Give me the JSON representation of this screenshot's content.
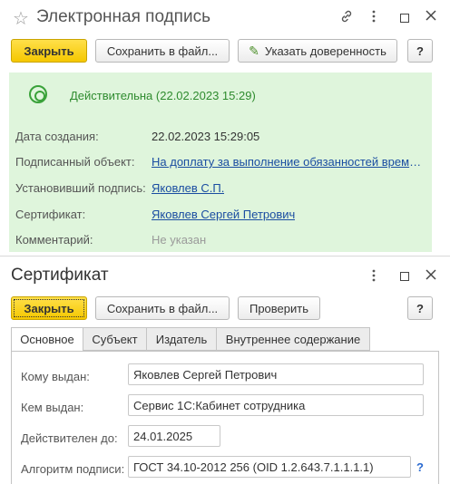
{
  "window1": {
    "title": "Электронная подпись",
    "buttons": {
      "close": "Закрыть",
      "save_to_file": "Сохранить в файл...",
      "set_proxy": "Указать доверенность",
      "help": "?"
    },
    "status": "Действительна (22.02.2023 15:29)",
    "fields": [
      {
        "label": "Дата создания:",
        "value": "22.02.2023 15:29:05"
      },
      {
        "label": "Подписанный объект:",
        "value": "На доплату за выполнение обязанностей време..."
      },
      {
        "label": "Установивший подпись:",
        "value": "Яковлев С.П."
      },
      {
        "label": "Сертификат:",
        "value": "Яковлев Сергей Петрович"
      },
      {
        "label": "Комментарий:",
        "value": "Не указан"
      }
    ]
  },
  "window2": {
    "title": "Сертификат",
    "buttons": {
      "close": "Закрыть",
      "save_to_file": "Сохранить в файл...",
      "verify": "Проверить",
      "help": "?"
    },
    "tabs": [
      "Основное",
      "Субъект",
      "Издатель",
      "Внутреннее содержание"
    ],
    "active_tab": "Основное",
    "fields": [
      {
        "label": "Кому выдан:",
        "value": "Яковлев Сергей Петрович"
      },
      {
        "label": "Кем выдан:",
        "value": "Сервис 1С:Кабинет сотрудника"
      },
      {
        "label": "Действителен до:",
        "value": "24.01.2025"
      },
      {
        "label": "Алгоритм подписи:",
        "value": "ГОСТ 34.10-2012 256 (OID 1.2.643.7.1.1.1.1)"
      }
    ],
    "field_help": "?"
  },
  "icons": {
    "favorite": "star-icon",
    "link": "link-icon",
    "more": "more-vertical-icon",
    "maximize": "maximize-icon",
    "close": "close-icon",
    "status": "valid-signature-icon",
    "proxy": "pencil-icon"
  },
  "colors": {
    "primary_button": "#f5c800",
    "valid_panel": "#dff5dc",
    "valid_text": "#2e8b2e",
    "link": "#1a4da1"
  }
}
